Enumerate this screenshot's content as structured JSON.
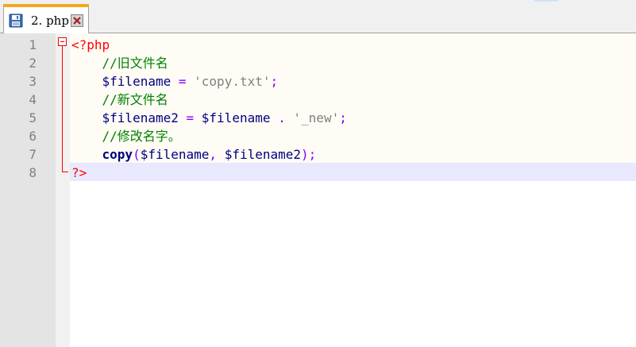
{
  "tab": {
    "label": "2. php"
  },
  "line_numbers": [
    "1",
    "2",
    "3",
    "4",
    "5",
    "6",
    "7",
    "8"
  ],
  "code": {
    "line1": {
      "tag_open": "<?php"
    },
    "line2": {
      "comment": "//旧文件名"
    },
    "line3": {
      "var": "$filename",
      "op": "=",
      "string": "'copy.txt'",
      "semi": ";"
    },
    "line4": {
      "comment": "//新文件名"
    },
    "line5": {
      "var": "$filename2",
      "op": "=",
      "var2": "$filename",
      "dot": ".",
      "string": "'_new'",
      "semi": ";"
    },
    "line6": {
      "comment": "//修改名字。"
    },
    "line7": {
      "func": "copy",
      "lparen": "(",
      "arg1": "$filename",
      "comma": ",",
      "arg2": "$filename2",
      "rparen": ")",
      "semi": ";"
    },
    "line8": {
      "tag_close": "?>"
    }
  },
  "colors": {
    "tab_accent": "#f5a623",
    "php_tag": "#ff0000",
    "comment": "#008000",
    "variable": "#000080",
    "operator": "#8000ff",
    "string": "#808080",
    "current_line": "#e8e8fe"
  },
  "icons": {
    "save": "floppy-disk-icon",
    "close": "close-x-icon"
  }
}
